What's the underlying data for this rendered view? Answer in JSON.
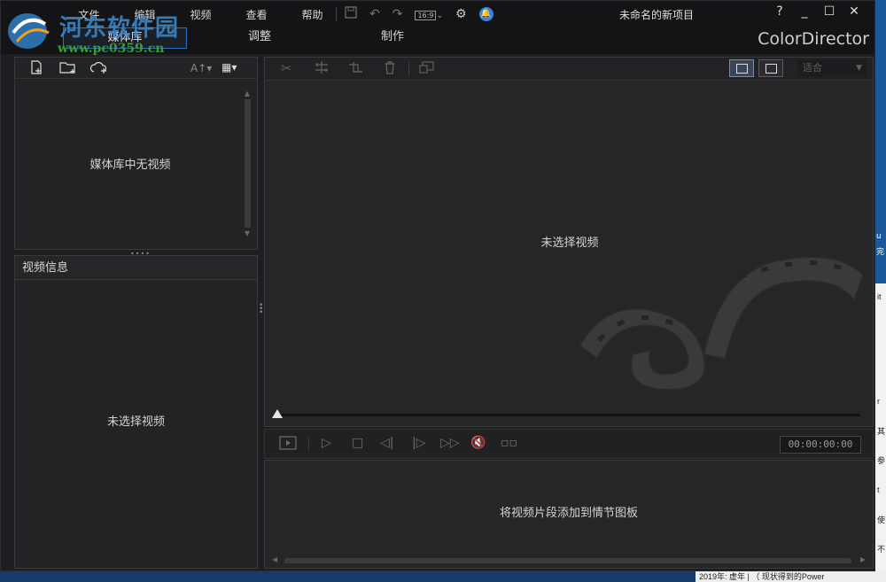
{
  "menu": [
    "文件",
    "编辑",
    "视频",
    "查看",
    "帮助"
  ],
  "toolbar": {
    "aspect_ratio": "16:9"
  },
  "project_title": "未命名的新项目",
  "window_controls": {
    "help": "?",
    "minimize": "_",
    "maximize": "☐",
    "close": "✕"
  },
  "tabs": [
    "媒体库",
    "调整",
    "制作"
  ],
  "active_tab": "媒体库",
  "brand": "ColorDirector",
  "watermark": {
    "name": "河东软件园",
    "url": "www.pc0359.cn"
  },
  "library": {
    "empty_text": "媒体库中无视频",
    "font_button": "A↑▾"
  },
  "info_panel": {
    "title": "视频信息",
    "empty_text": "未选择视频"
  },
  "preview": {
    "empty_text": "未选择视频",
    "zoom": "适合",
    "progress": 0
  },
  "transport": {
    "timecode": "00:00:00:00"
  },
  "storyboard": {
    "empty_text": "将视频片段添加到情节图板"
  },
  "background_windows": {
    "doc_line": "2019年: 虚年 | （ 现状得到的Power",
    "side_chars": [
      "u",
      "完",
      "it",
      "r",
      "其",
      "参",
      "t",
      "使",
      "不"
    ]
  },
  "colors": {
    "accent": "#2d6fc0",
    "bell": "#3b82e0",
    "background": "#1e1e20"
  }
}
